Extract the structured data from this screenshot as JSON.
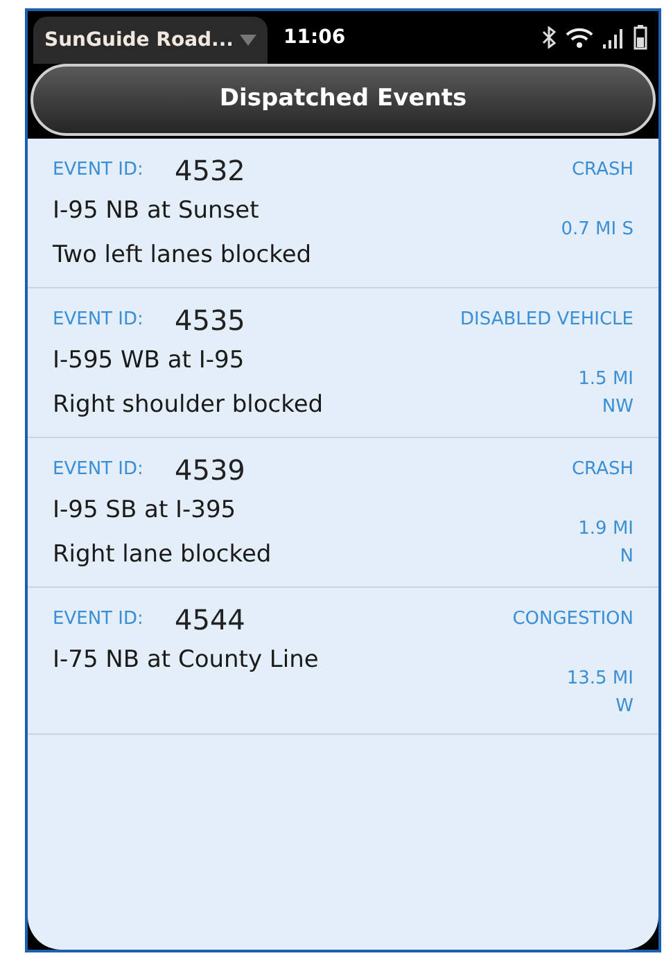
{
  "status_bar": {
    "app_title": "SunGuide Road...",
    "time": "11:06"
  },
  "header": {
    "title": "Dispatched Events"
  },
  "events": [
    {
      "id_label": "EVENT ID:",
      "id": "4532",
      "type": "CRASH",
      "location": "I-95 NB at Sunset",
      "description": "Two left lanes blocked",
      "distance": [
        "0.7 MI S"
      ]
    },
    {
      "id_label": "EVENT ID:",
      "id": "4535",
      "type": "DISABLED VEHICLE",
      "location": "I-595 WB at I-95",
      "description": "Right shoulder blocked",
      "distance": [
        "1.5 MI",
        "NW"
      ]
    },
    {
      "id_label": "EVENT ID:",
      "id": "4539",
      "type": "CRASH",
      "location": "I-95 SB at I-395",
      "description": "Right lane blocked",
      "distance": [
        "1.9 MI",
        "N"
      ]
    },
    {
      "id_label": "EVENT ID:",
      "id": "4544",
      "type": "CONGESTION",
      "location": "I-75 NB at County Line",
      "distance": [
        "13.5 MI",
        "W"
      ]
    }
  ]
}
